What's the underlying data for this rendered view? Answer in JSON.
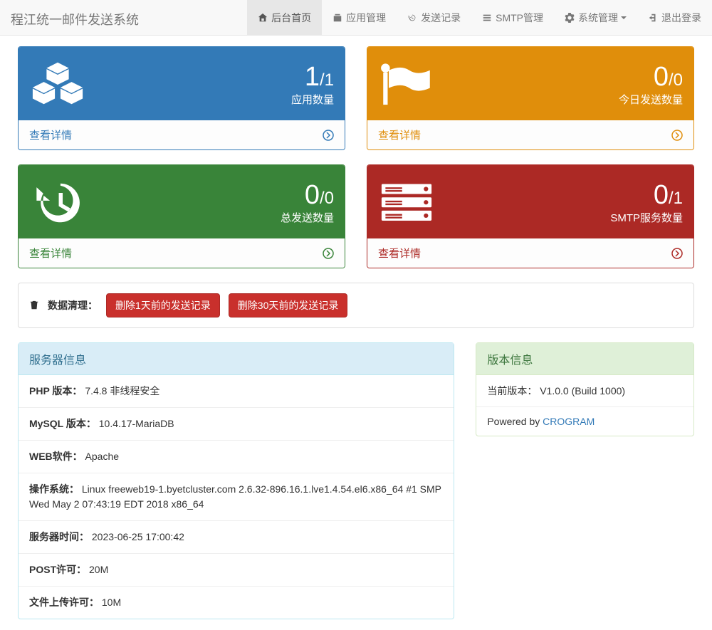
{
  "navbar": {
    "brand": "程江统一邮件发送系统",
    "items": [
      {
        "label": "后台首页"
      },
      {
        "label": "应用管理"
      },
      {
        "label": "发送记录"
      },
      {
        "label": "SMTP管理"
      },
      {
        "label": "系统管理"
      },
      {
        "label": "退出登录"
      }
    ]
  },
  "cards": {
    "app": {
      "num": "1",
      "denom": "/1",
      "label": "应用数量",
      "footer": "查看详情"
    },
    "today": {
      "num": "0",
      "denom": "/0",
      "label": "今日发送数量",
      "footer": "查看详情"
    },
    "total": {
      "num": "0",
      "denom": "/0",
      "label": "总发送数量",
      "footer": "查看详情"
    },
    "smtp": {
      "num": "0",
      "denom": "/1",
      "label": "SMTP服务数量",
      "footer": "查看详情"
    }
  },
  "clean": {
    "title": "数据清理：",
    "btn1": "删除1天前的发送记录",
    "btn2": "删除30天前的发送记录"
  },
  "server": {
    "heading": "服务器信息",
    "rows": [
      {
        "k": "PHP 版本：",
        "v": "7.4.8 非线程安全"
      },
      {
        "k": "MySQL 版本：",
        "v": "10.4.17-MariaDB"
      },
      {
        "k": "WEB软件：",
        "v": "Apache"
      },
      {
        "k": "操作系统：",
        "v": "Linux freeweb19-1.byetcluster.com 2.6.32-896.16.1.lve1.4.54.el6.x86_64 #1 SMP Wed May 2 07:43:19 EDT 2018 x86_64"
      },
      {
        "k": "服务器时间：",
        "v": "2023-06-25 17:00:42"
      },
      {
        "k": "POST许可：",
        "v": "20M"
      },
      {
        "k": "文件上传许可：",
        "v": "10M"
      }
    ]
  },
  "version": {
    "heading": "版本信息",
    "row1k": "当前版本：",
    "row1v": "V1.0.0 (Build 1000)",
    "row2a": "Powered by ",
    "row2b": "CROGRAM"
  }
}
